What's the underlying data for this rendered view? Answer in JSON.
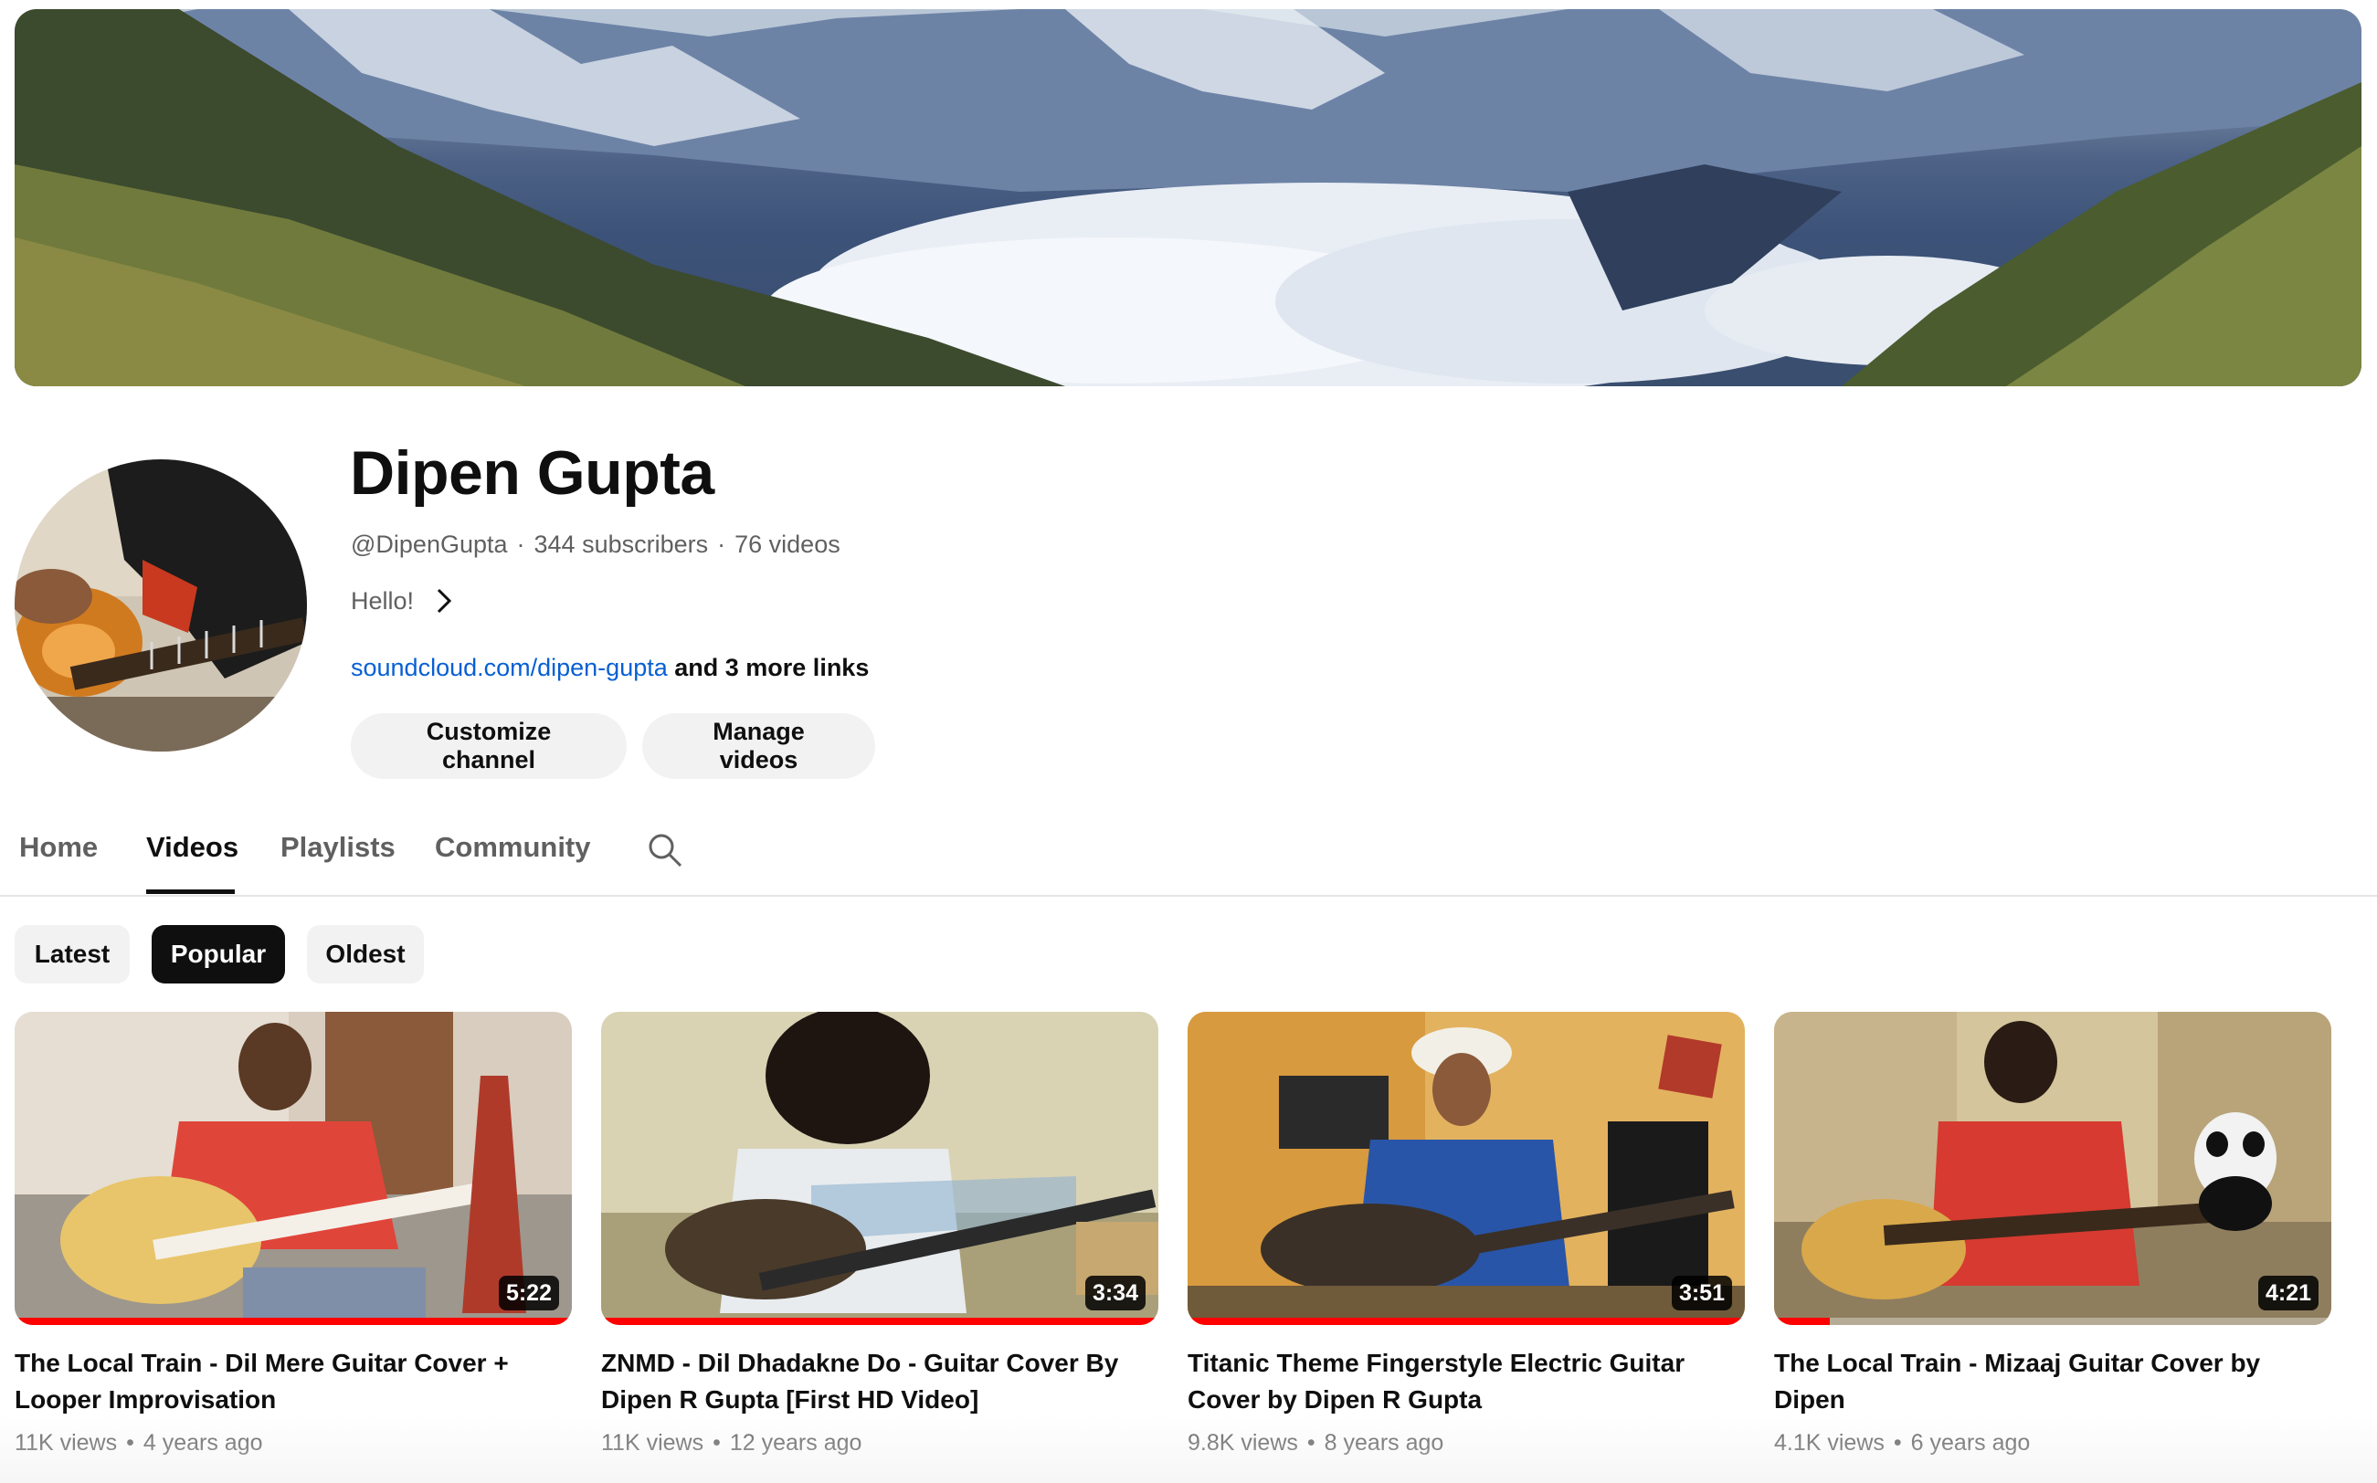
{
  "channel": {
    "name": "Dipen Gupta",
    "handle": "@DipenGupta",
    "subscribers": "344 subscribers",
    "videos_count": "76 videos",
    "meta_separator": "·",
    "description": "Hello!",
    "link_text": "soundcloud.com/dipen-gupta",
    "more_links": "and 3 more links"
  },
  "actions": {
    "customize_label": "Customize channel",
    "manage_label": "Manage videos"
  },
  "tabs": [
    {
      "label": "Home",
      "active": false
    },
    {
      "label": "Videos",
      "active": true
    },
    {
      "label": "Playlists",
      "active": false
    },
    {
      "label": "Community",
      "active": false
    }
  ],
  "tab_search_icon": "search-icon",
  "chips": [
    {
      "label": "Latest",
      "selected": false
    },
    {
      "label": "Popular",
      "selected": true
    },
    {
      "label": "Oldest",
      "selected": false
    }
  ],
  "videos": [
    {
      "title": "The Local Train - Dil Mere Guitar Cover + Looper Improvisation",
      "views": "11K views",
      "age": "4 years ago",
      "duration": "5:22",
      "watched_fraction": 1.0
    },
    {
      "title": "ZNMD - Dil Dhadakne Do - Guitar Cover By Dipen R Gupta [First HD Video]",
      "views": "11K views",
      "age": "12 years ago",
      "duration": "3:34",
      "watched_fraction": 1.0
    },
    {
      "title": "Titanic Theme Fingerstyle Electric Guitar Cover by Dipen R Gupta",
      "views": "9.8K views",
      "age": "8 years ago",
      "duration": "3:51",
      "watched_fraction": 1.0
    },
    {
      "title": "The Local Train - Mizaaj Guitar Cover by Dipen",
      "views": "4.1K views",
      "age": "6 years ago",
      "duration": "4:21",
      "watched_fraction": 0.1
    }
  ],
  "meta_dot": "•",
  "colors": {
    "accent": "#065fd4",
    "progress": "#ff0000",
    "chip_selected": "#0f0f0f",
    "chip_bg": "#f2f2f2"
  }
}
